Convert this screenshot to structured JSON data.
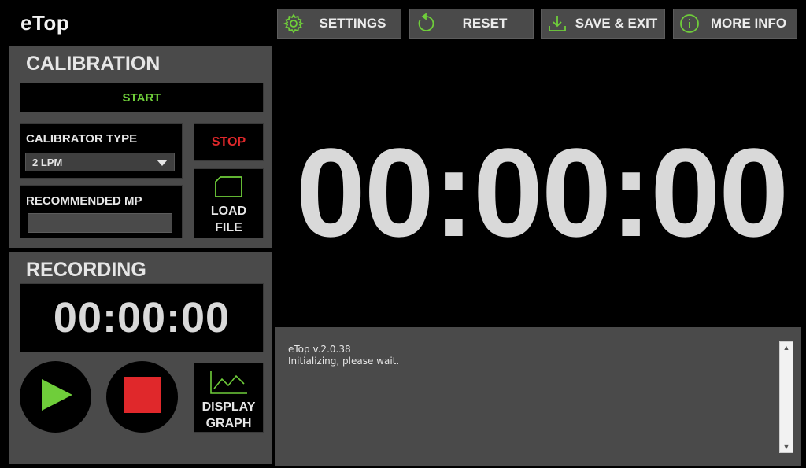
{
  "app": {
    "title": "eTop"
  },
  "toolbar": {
    "settings_label": "SETTINGS",
    "reset_label": "RESET",
    "save_exit_label": "SAVE & EXIT",
    "more_info_label": "MORE INFO",
    "icons": [
      "gear-icon",
      "reset-icon",
      "download-icon",
      "info-icon"
    ]
  },
  "calibration": {
    "title": "CALIBRATION",
    "start_label": "START",
    "stop_label": "STOP",
    "calibrator_type_label": "CALIBRATOR TYPE",
    "calibrator_type_value": "2 LPM",
    "recommended_mp_label": "RECOMMENDED MP",
    "recommended_mp_value": "",
    "load_file_label_1": "LOAD",
    "load_file_label_2": "FILE"
  },
  "recording": {
    "title": "RECORDING",
    "time": "00:00:00",
    "display_graph_label_1": "DISPLAY",
    "display_graph_label_2": "GRAPH"
  },
  "main": {
    "timer": "00:00:00"
  },
  "log": {
    "lines": [
      "eTop v.2.0.38",
      "Initializing, please wait."
    ]
  },
  "colors": {
    "accent_green": "#6fce3a",
    "stop_red": "#e0282b",
    "panel_gray": "#4a4a4a",
    "background": "#000000"
  }
}
